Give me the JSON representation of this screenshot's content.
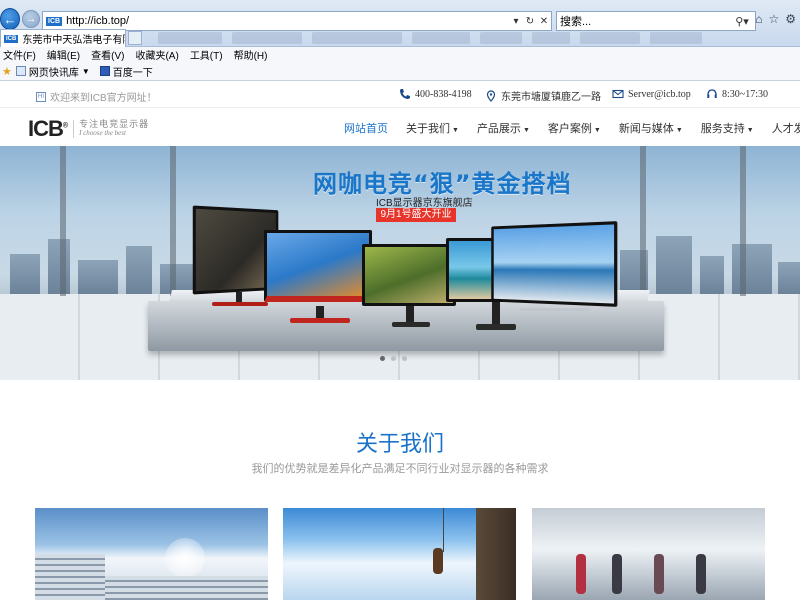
{
  "browser": {
    "url": "http://icb.top/",
    "search_placeholder": "搜索...",
    "tab_title": "东莞市中天弘浩电子有限公...",
    "menu": [
      "文件(F)",
      "编辑(E)",
      "查看(V)",
      "收藏夹(A)",
      "工具(T)",
      "帮助(H)"
    ],
    "favorites": [
      "网页快讯库",
      "百度一下"
    ]
  },
  "topbar": {
    "welcome": "欢迎来到ICB官方网址！",
    "phone": "400-838-4198",
    "address": "东莞市塘厦镇鹿乙一路",
    "email": "Server@icb.top",
    "hours": "8:30~17:30"
  },
  "logo": {
    "brand": "ICB",
    "tagline_cn": "专注电竞显示器",
    "tagline_en": "I choose the best"
  },
  "nav": [
    {
      "label": "网站首页",
      "active": true,
      "dropdown": false
    },
    {
      "label": "关于我们",
      "active": false,
      "dropdown": true
    },
    {
      "label": "产品展示",
      "active": false,
      "dropdown": true
    },
    {
      "label": "客户案例",
      "active": false,
      "dropdown": true
    },
    {
      "label": "新闻与媒体",
      "active": false,
      "dropdown": true
    },
    {
      "label": "服务支持",
      "active": false,
      "dropdown": true
    },
    {
      "label": "人才发展",
      "active": false,
      "dropdown": false
    }
  ],
  "banner": {
    "headline": "网咖电竞“狠”黄金搭档",
    "subtitle": "ICB显示器京东旗舰店",
    "date_badge": "9月1号盛大开业",
    "slide_count": 3,
    "active_slide": 1
  },
  "about": {
    "title": "关于我们",
    "subtitle": "我们的优势就是差异化产品满足不同行业对显示器的各种需求"
  },
  "colors": {
    "accent": "#1a73c9",
    "badge_red": "#e8352c"
  }
}
